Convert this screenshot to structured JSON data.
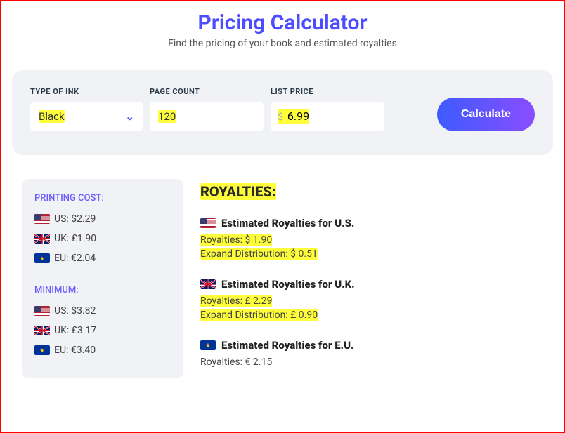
{
  "header": {
    "title": "Pricing Calculator",
    "subtitle": "Find the pricing of your book and estimated royalties"
  },
  "form": {
    "ink": {
      "label": "TYPE OF INK",
      "value": "Black"
    },
    "pages": {
      "label": "PAGE COUNT",
      "value": "120"
    },
    "price": {
      "label": "LIST PRICE",
      "currency": "$",
      "value": "6.99"
    },
    "calculate": "Calculate"
  },
  "printing": {
    "heading": "PRINTING COST:",
    "items": [
      {
        "label": "US: $2.29"
      },
      {
        "label": "UK: £1.90"
      },
      {
        "label": "EU: €2.04"
      }
    ]
  },
  "minimum": {
    "heading": "MINIMUM:",
    "items": [
      {
        "label": "US: $3.82"
      },
      {
        "label": "UK: £3.17"
      },
      {
        "label": "EU: €3.40"
      }
    ]
  },
  "royalties": {
    "heading": "ROYALTIES:",
    "us": {
      "title": "Estimated Royalties for U.S.",
      "line1": "Royalties: $ 1.90",
      "line2": "Expand Distribution: $ 0.51"
    },
    "uk": {
      "title": "Estimated Royalties for U.K.",
      "line1": "Royalties: £ 2.29",
      "line2": "Expand Distribution: £ 0.90"
    },
    "eu": {
      "title": "Estimated Royalties for E.U.",
      "line1": "Royalties: € 2.15"
    }
  }
}
